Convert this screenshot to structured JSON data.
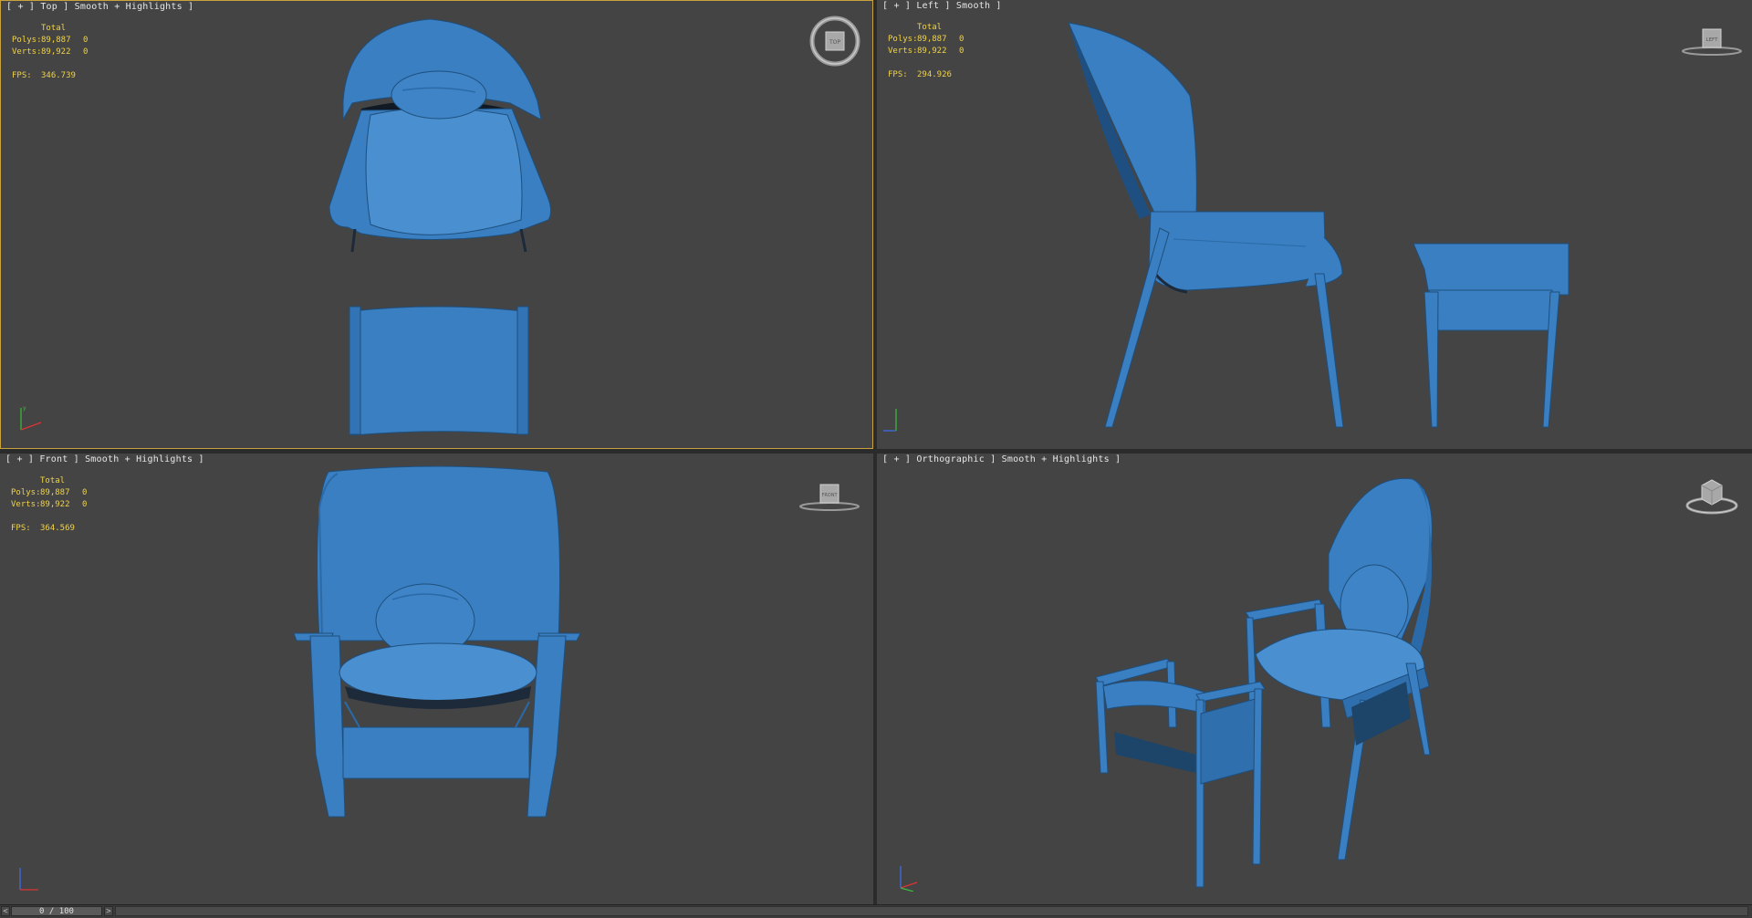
{
  "viewports": [
    {
      "label": "[ + ] Top ] Smooth + Highlights ]",
      "stats": {
        "total": "Total",
        "polys_label": "Polys:",
        "polys": "89,887",
        "polys_sel": "0",
        "verts_label": "Verts:",
        "verts": "89,922",
        "verts_sel": "0",
        "fps_label": "FPS:",
        "fps": "346.739"
      },
      "viewcube_label": "TOP",
      "active": true
    },
    {
      "label": "[ + ] Left ] Smooth ]",
      "stats": {
        "total": "Total",
        "polys_label": "Polys:",
        "polys": "89,887",
        "polys_sel": "0",
        "verts_label": "Verts:",
        "verts": "89,922",
        "verts_sel": "0",
        "fps_label": "FPS:",
        "fps": "294.926"
      },
      "viewcube_label": "LEFT"
    },
    {
      "label": "[ + ] Front ] Smooth + Highlights ]",
      "stats": {
        "total": "Total",
        "polys_label": "Polys:",
        "polys": "89,887",
        "polys_sel": "0",
        "verts_label": "Verts:",
        "verts": "89,922",
        "verts_sel": "0",
        "fps_label": "FPS:",
        "fps": "364.569"
      },
      "viewcube_label": "FRONT"
    },
    {
      "label": "[ + ] Orthographic ] Smooth + Highlights ]",
      "stats": null,
      "viewcube_label": ""
    }
  ],
  "timeline": {
    "frame": "0 / 100",
    "prev": "<",
    "next": ">"
  },
  "colors": {
    "model": "#3a7fc1",
    "viewport_bg": "#444444",
    "active_border": "#c8a23c",
    "stats_text": "#f0d34a"
  }
}
